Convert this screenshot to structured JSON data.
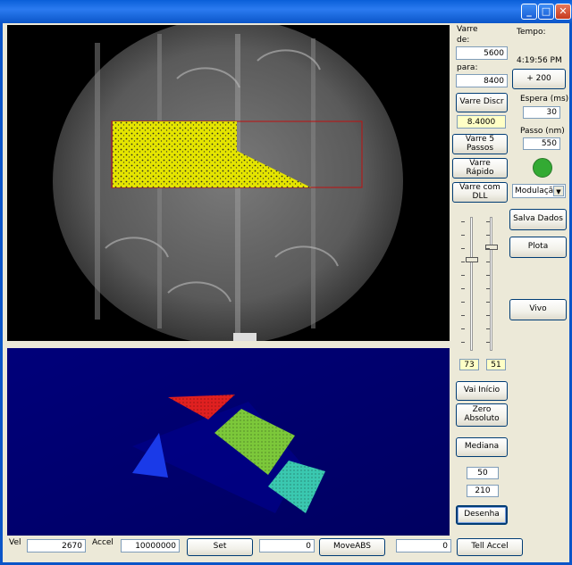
{
  "scan": {
    "label_varre": "Varre",
    "label_de": "de:",
    "from_value": "5600",
    "label_para": "para:",
    "to_value": "8400",
    "discrete_button": "Varre Discr",
    "current_value": "8.4000",
    "five_steps_button": "Varre 5 Passos",
    "fast_button": "Varre Rápido",
    "dll_button": "Varre com DLL"
  },
  "timing": {
    "label_tempo": "Tempo:",
    "time_value": "4:19:56 PM",
    "plus_button": "+ 200",
    "label_wait": "Espera (ms)",
    "wait_value": "30",
    "label_step": "Passo (nm)",
    "step_value": "550",
    "status_color": "#33AA33",
    "mode_value": "Modulação"
  },
  "actions": {
    "save_button": "Salva Dados",
    "plot_button": "Plota",
    "live_button": "Vivo"
  },
  "sliders": {
    "left_value": "73",
    "right_value": "51"
  },
  "controls": {
    "home_button": "Vai Início",
    "zero_button": "Zero Absoluto",
    "median_button": "Mediana",
    "value_a": "50",
    "value_b": "210",
    "draw_button": "Desenha"
  },
  "bottom": {
    "label_vel": "Vel",
    "vel_value": "2670",
    "label_accel": "Accel",
    "accel_value": "10000000",
    "set_button": "Set",
    "position_value": "0",
    "moveabs_button": "MoveABS",
    "tell_value": "0",
    "tell_accel_button": "Tell Accel"
  }
}
